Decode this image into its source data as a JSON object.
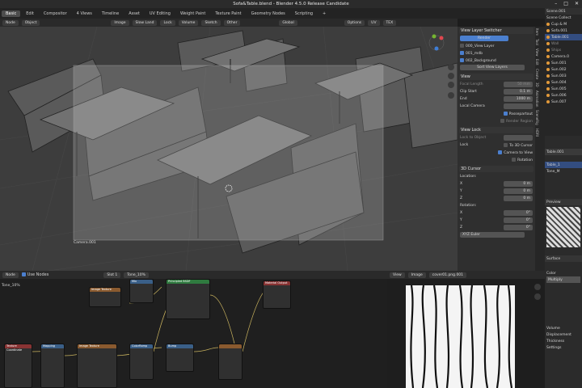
{
  "window": {
    "title": "Sofa&Table.blend - Blender 4.5.0 Release Candidate",
    "controls": [
      "–",
      "□",
      "✕"
    ]
  },
  "menu": {
    "items": [
      "Basic",
      "Edit",
      "Compositor",
      "4 Views",
      "Timeline",
      "Asset",
      "UV Editing",
      "Weight Paint",
      "Texture Paint",
      "Geometry Nodes",
      "Scripting",
      "+"
    ],
    "active": 0,
    "header_left": [
      "Node",
      "Object"
    ]
  },
  "viewport": {
    "header_items": [
      "Image",
      "Slow Land",
      "Lock",
      "Volume",
      "Sketch",
      "Other",
      "Global",
      "Options",
      "UV",
      "TEX"
    ],
    "camera_label": "Camera.001"
  },
  "npanel": {
    "view_layer_switcher": {
      "title": "View Layer Switcher",
      "render_label": "Render",
      "layers": [
        "000_View Layer",
        "001_mdb",
        "002_Background"
      ],
      "set_button": "Sort View Layers"
    },
    "view": {
      "title": "View",
      "focal_length_label": "Focal Length",
      "focal_length": "50 mm",
      "clip_start_label": "Clip Start",
      "clip_start": "0.1 m",
      "end_label": "End",
      "end": "1000 m",
      "local_camera_label": "Local Camera",
      "passepartout": "Passepartout",
      "render_region": "Render Region"
    },
    "view_lock": {
      "title": "View Lock",
      "lock_to_object": "Lock to Object",
      "lock_label": "Lock",
      "to_3d_cursor": "To 3D Cursor",
      "camera_to_view": "Camera to View",
      "rotation": "Rotation"
    },
    "cursor": {
      "title": "3D Cursor",
      "location": "Location:",
      "rotation": "Rotation:",
      "x": "X",
      "y": "Y",
      "z": "Z",
      "loc_values": [
        "0 m",
        "0 m",
        "0 m"
      ],
      "rot_values": [
        "0°",
        "0°",
        "0°"
      ],
      "mode": "XYZ Euler"
    }
  },
  "ntabs": [
    "Item",
    "Tool",
    "View",
    "Edit",
    "Create",
    "3D",
    "Animation",
    "SceneRig",
    "HDRI"
  ],
  "outliner": {
    "header": "Scene.001",
    "items": [
      "Scene Collect",
      "Cup & M",
      "Sofa.001",
      "Table.001",
      "Wall",
      "Ships",
      "Camera.0",
      "Sun.001",
      "Sun.002",
      "Sun.003",
      "Sun.004",
      "Sun.005",
      "Sun.006",
      "Sun.007"
    ]
  },
  "props": {
    "object": "Table.001",
    "slot": "Table_1",
    "mat": "Tone_M",
    "preview": "Preview",
    "surface": "Surface",
    "color": "Color",
    "multiply": "Multiply",
    "volume": "Volume",
    "displacement": "Displacement",
    "thickness": "Thickness",
    "settings": "Settings"
  },
  "node_editor": {
    "header_items": [
      "Node",
      "Use Nodes",
      "Slot 1",
      "Tone_10%"
    ],
    "material": "Tone_10%",
    "nodes": [
      "Texture Coordinate",
      "Mapping",
      "Image Texture",
      "Image Texture",
      "ColorRamp",
      "Bump",
      "Mix",
      "Principled BSDF",
      "Material Output"
    ]
  },
  "image_editor": {
    "header_items": [
      "View",
      "Image",
      "cover01.png.001"
    ]
  }
}
